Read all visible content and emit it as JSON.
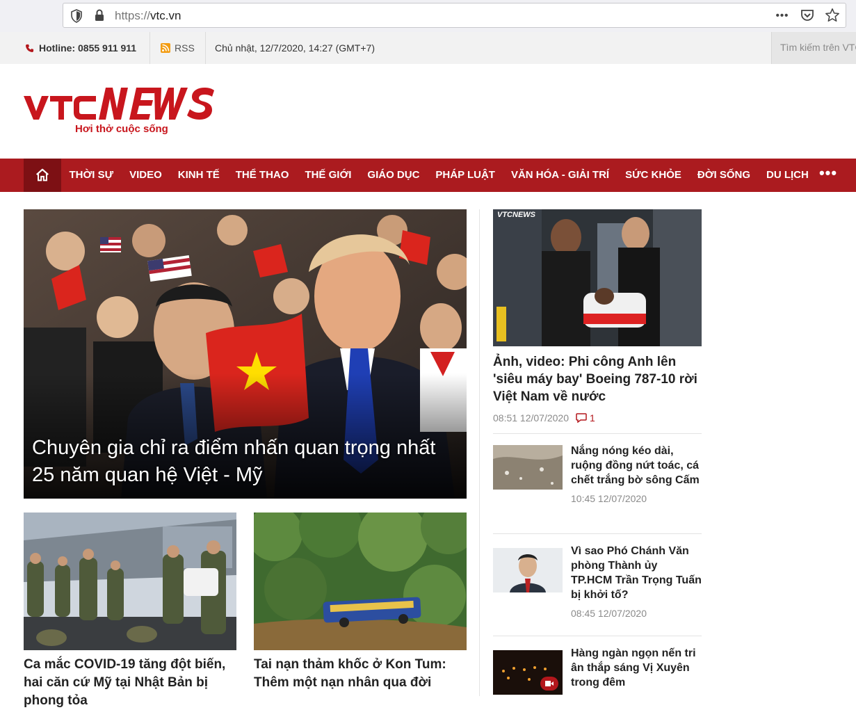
{
  "browser": {
    "url_protocol": "https://",
    "url_host": "vtc.vn",
    "menu_glyph": "•••"
  },
  "topstrip": {
    "hotline": "Hotline: 0855 911 911",
    "rss": "RSS",
    "datetime": "Chủ nhật, 12/7/2020, 14:27 (GMT+7)",
    "search_placeholder": "Tìm kiếm trên VTC"
  },
  "logo": {
    "text_vtc": "VTC",
    "text_news": "NEWS",
    "tagline": "Hơi thở cuộc sống"
  },
  "nav": {
    "items": [
      "THỜI SỰ",
      "VIDEO",
      "KINH TẾ",
      "THỂ THAO",
      "THẾ GIỚI",
      "GIÁO DỤC",
      "PHÁP LUẬT",
      "VĂN HÓA - GIẢI TRÍ",
      "SỨC KHỎE",
      "ĐỜI SỐNG",
      "DU LỊCH"
    ],
    "more": "•••"
  },
  "hero": {
    "title": "Chuyên gia chỉ ra điểm nhấn quan trọng nhất 25 năm quan hệ Việt - Mỹ"
  },
  "sub_articles": [
    {
      "title": "Ca mắc COVID-19 tăng đột biến, hai căn cứ Mỹ tại Nhật Bản bị phong tỏa"
    },
    {
      "title": "Tai nạn thảm khốc ở Kon Tum: Thêm một nạn nhân qua đời"
    }
  ],
  "right_top": {
    "thumb_watermark": "VTCNEWS",
    "title": "Ảnh, video: Phi công Anh lên 'siêu máy bay' Boeing 787-10 rời Việt Nam về nước",
    "time": "08:51 12/07/2020",
    "comments": "1"
  },
  "right_list": [
    {
      "title": "Nắng nóng kéo dài, ruộng đồng nứt toác, cá chết trắng bờ sông Cấm",
      "time": "10:45 12/07/2020"
    },
    {
      "title": "Vì sao Phó Chánh Văn phòng Thành ủy TP.HCM Trần Trọng Tuấn bị khởi tố?",
      "time": "08:45 12/07/2020"
    },
    {
      "title": "Hàng ngàn ngọn nến tri ân thắp sáng Vị Xuyên trong đêm",
      "time": ""
    }
  ],
  "colors": {
    "brand_red": "#ab1b1f",
    "brand_dark_red": "#7d1014"
  },
  "icons": [
    "shield-icon",
    "lock-icon",
    "more-icon",
    "pocket-icon",
    "star-icon",
    "phone-icon",
    "rss-icon",
    "home-icon",
    "comment-icon",
    "video-icon"
  ]
}
